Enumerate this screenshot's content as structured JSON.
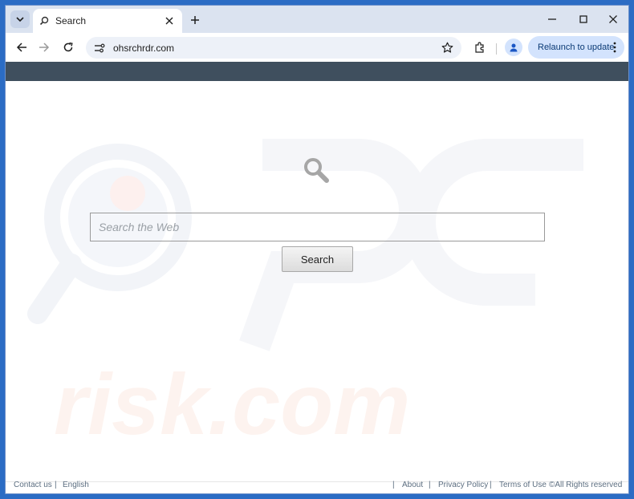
{
  "browser": {
    "tab_title": "Search",
    "url": "ohsrchrdr.com",
    "relaunch_label": "Relaunch to update"
  },
  "page": {
    "search_placeholder": "Search the Web",
    "search_button": "Search",
    "watermark_text": "risk.com"
  },
  "footer": {
    "left_links": [
      "Contact us",
      "English"
    ],
    "right_links": [
      "About",
      "Privacy Policy",
      "Terms of Use"
    ],
    "copyright": "©All Rights reserved",
    "separator": "|"
  },
  "colors": {
    "page_topbar": "#3f4f5e",
    "accent": "#1a73e8"
  }
}
